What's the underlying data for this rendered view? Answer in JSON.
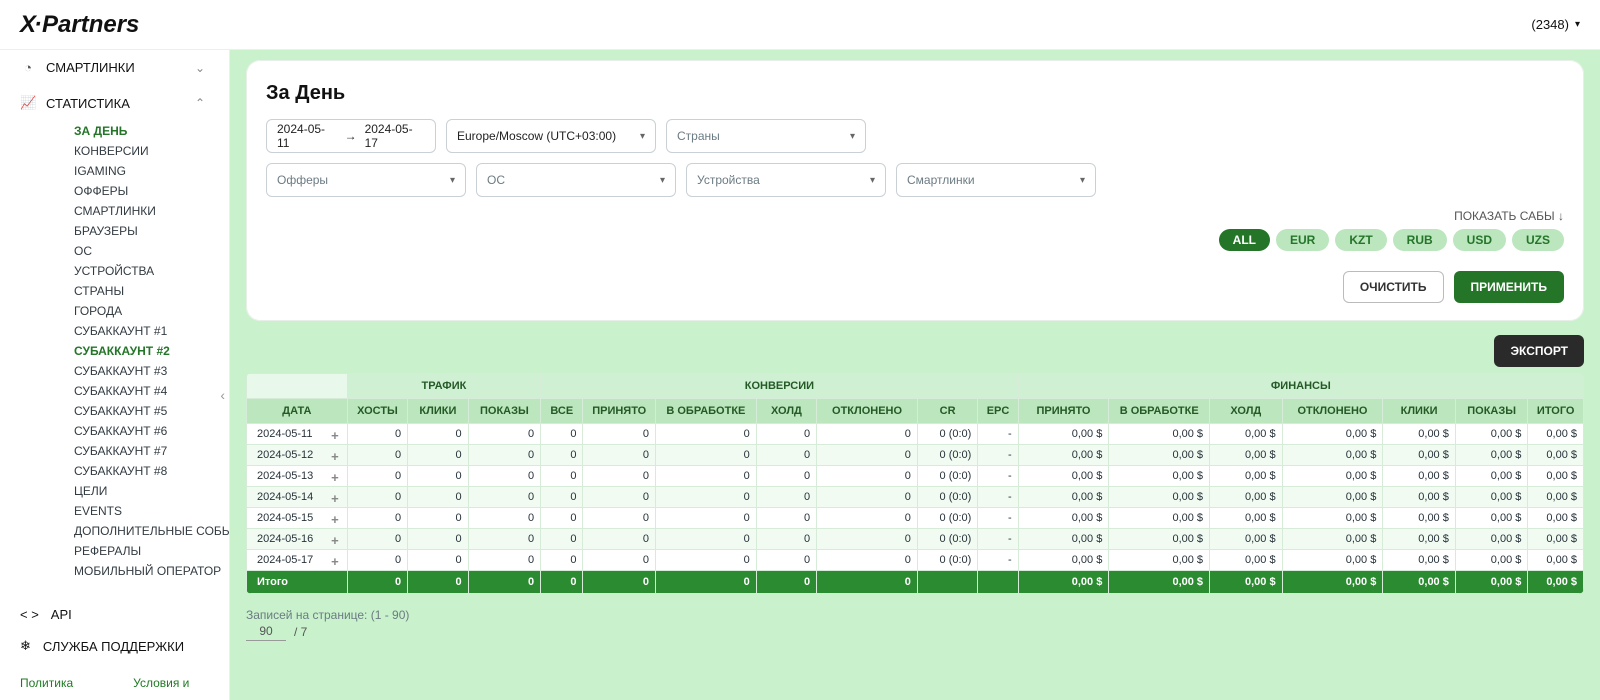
{
  "header": {
    "brand": "X·Partners",
    "account_id": "(2348)"
  },
  "sidebar": {
    "smartlinks": "СМАРТЛИНКИ",
    "stats": "СТАТИСТИКА",
    "items_groupA": [
      "ЗА ДЕНЬ",
      "КОНВЕРСИИ",
      "IGAMING",
      "ОФФЕРЫ",
      "СМАРТЛИНКИ",
      "БРАУЗЕРЫ",
      "ОС",
      "УСТРОЙСТВА",
      "СТРАНЫ",
      "ГОРОДА"
    ],
    "subaccounts": [
      "СУБАККАУНТ #1",
      "СУБАККАУНТ #2",
      "СУБАККАУНТ #3",
      "СУБАККАУНТ #4",
      "СУБАККАУНТ #5",
      "СУБАККАУНТ #6",
      "СУБАККАУНТ #7",
      "СУБАККАУНТ #8"
    ],
    "items_groupB": [
      "ЦЕЛИ",
      "EVENTS",
      "ДОПОЛНИТЕЛЬНЫЕ СОБЫТИЯ",
      "РЕФЕРАЛЫ",
      "МОБИЛЬНЫЙ ОПЕРАТОР"
    ],
    "active_item": "ЗА ДЕНЬ",
    "active_sub": "СУБАККАУНТ #2",
    "api": "API",
    "support": "СЛУЖБА ПОДДЕРЖКИ",
    "policy": "Политика",
    "terms": "Условия и"
  },
  "page": {
    "title": "За День",
    "date_from": "2024-05-11",
    "date_to": "2024-05-17",
    "timezone": "Europe/Moscow (UTC+03:00)",
    "ph_countries": "Страны",
    "ph_offers": "Офферы",
    "ph_os": "ОС",
    "ph_devices": "Устройства",
    "ph_smartlinks": "Смартлинки",
    "show_subs": "ПОКАЗАТЬ САБЫ ↓",
    "currencies": [
      "ALL",
      "EUR",
      "KZT",
      "RUB",
      "USD",
      "UZS"
    ],
    "currency_active": "ALL",
    "btn_clear": "ОЧИСТИТЬ",
    "btn_apply": "ПРИМЕНИТЬ",
    "btn_export": "ЭКСПОРТ"
  },
  "table": {
    "groups": {
      "traffic": "ТРАФИК",
      "conversions": "КОНВЕРСИИ",
      "finance": "ФИНАНСЫ"
    },
    "cols": {
      "date": "ДАТА",
      "hosts": "ХОСТЫ",
      "clicks": "КЛИКИ",
      "shows": "ПОКАЗЫ",
      "all": "ВСЕ",
      "accepted": "ПРИНЯТО",
      "processing": "В ОБРАБОТКЕ",
      "hold": "ХОЛД",
      "rejected": "ОТКЛОНЕНО",
      "cr": "CR",
      "epc": "EPC",
      "f_accepted": "ПРИНЯТО",
      "f_processing": "В ОБРАБОТКЕ",
      "f_hold": "ХОЛД",
      "f_rejected": "ОТКЛОНЕНО",
      "f_clicks": "КЛИКИ",
      "f_shows": "ПОКАЗЫ",
      "f_total": "ИТОГО"
    },
    "rows": [
      {
        "date": "2024-05-11",
        "hosts": "0",
        "clicks": "0",
        "shows": "0",
        "all": "0",
        "accepted": "0",
        "processing": "0",
        "hold": "0",
        "rejected": "0",
        "cr": "0 (0:0)",
        "epc": "-",
        "fa": "0,00 $",
        "fp": "0,00 $",
        "fh": "0,00 $",
        "fr": "0,00 $",
        "fc": "0,00 $",
        "fs": "0,00 $",
        "ft": "0,00 $"
      },
      {
        "date": "2024-05-12",
        "hosts": "0",
        "clicks": "0",
        "shows": "0",
        "all": "0",
        "accepted": "0",
        "processing": "0",
        "hold": "0",
        "rejected": "0",
        "cr": "0 (0:0)",
        "epc": "-",
        "fa": "0,00 $",
        "fp": "0,00 $",
        "fh": "0,00 $",
        "fr": "0,00 $",
        "fc": "0,00 $",
        "fs": "0,00 $",
        "ft": "0,00 $"
      },
      {
        "date": "2024-05-13",
        "hosts": "0",
        "clicks": "0",
        "shows": "0",
        "all": "0",
        "accepted": "0",
        "processing": "0",
        "hold": "0",
        "rejected": "0",
        "cr": "0 (0:0)",
        "epc": "-",
        "fa": "0,00 $",
        "fp": "0,00 $",
        "fh": "0,00 $",
        "fr": "0,00 $",
        "fc": "0,00 $",
        "fs": "0,00 $",
        "ft": "0,00 $"
      },
      {
        "date": "2024-05-14",
        "hosts": "0",
        "clicks": "0",
        "shows": "0",
        "all": "0",
        "accepted": "0",
        "processing": "0",
        "hold": "0",
        "rejected": "0",
        "cr": "0 (0:0)",
        "epc": "-",
        "fa": "0,00 $",
        "fp": "0,00 $",
        "fh": "0,00 $",
        "fr": "0,00 $",
        "fc": "0,00 $",
        "fs": "0,00 $",
        "ft": "0,00 $"
      },
      {
        "date": "2024-05-15",
        "hosts": "0",
        "clicks": "0",
        "shows": "0",
        "all": "0",
        "accepted": "0",
        "processing": "0",
        "hold": "0",
        "rejected": "0",
        "cr": "0 (0:0)",
        "epc": "-",
        "fa": "0,00 $",
        "fp": "0,00 $",
        "fh": "0,00 $",
        "fr": "0,00 $",
        "fc": "0,00 $",
        "fs": "0,00 $",
        "ft": "0,00 $"
      },
      {
        "date": "2024-05-16",
        "hosts": "0",
        "clicks": "0",
        "shows": "0",
        "all": "0",
        "accepted": "0",
        "processing": "0",
        "hold": "0",
        "rejected": "0",
        "cr": "0 (0:0)",
        "epc": "-",
        "fa": "0,00 $",
        "fp": "0,00 $",
        "fh": "0,00 $",
        "fr": "0,00 $",
        "fc": "0,00 $",
        "fs": "0,00 $",
        "ft": "0,00 $"
      },
      {
        "date": "2024-05-17",
        "hosts": "0",
        "clicks": "0",
        "shows": "0",
        "all": "0",
        "accepted": "0",
        "processing": "0",
        "hold": "0",
        "rejected": "0",
        "cr": "0 (0:0)",
        "epc": "-",
        "fa": "0,00 $",
        "fp": "0,00 $",
        "fh": "0,00 $",
        "fr": "0,00 $",
        "fc": "0,00 $",
        "fs": "0,00 $",
        "ft": "0,00 $"
      }
    ],
    "total": {
      "label": "Итого",
      "hosts": "0",
      "clicks": "0",
      "shows": "0",
      "all": "0",
      "accepted": "0",
      "processing": "0",
      "hold": "0",
      "rejected": "0",
      "cr": "",
      "epc": "",
      "fa": "0,00 $",
      "fp": "0,00 $",
      "fh": "0,00 $",
      "fr": "0,00 $",
      "fc": "0,00 $",
      "fs": "0,00 $",
      "ft": "0,00 $"
    }
  },
  "pager": {
    "records_label": "Записей на странице: (1 - 90)",
    "per_page": "90",
    "separator": "/ 7"
  }
}
